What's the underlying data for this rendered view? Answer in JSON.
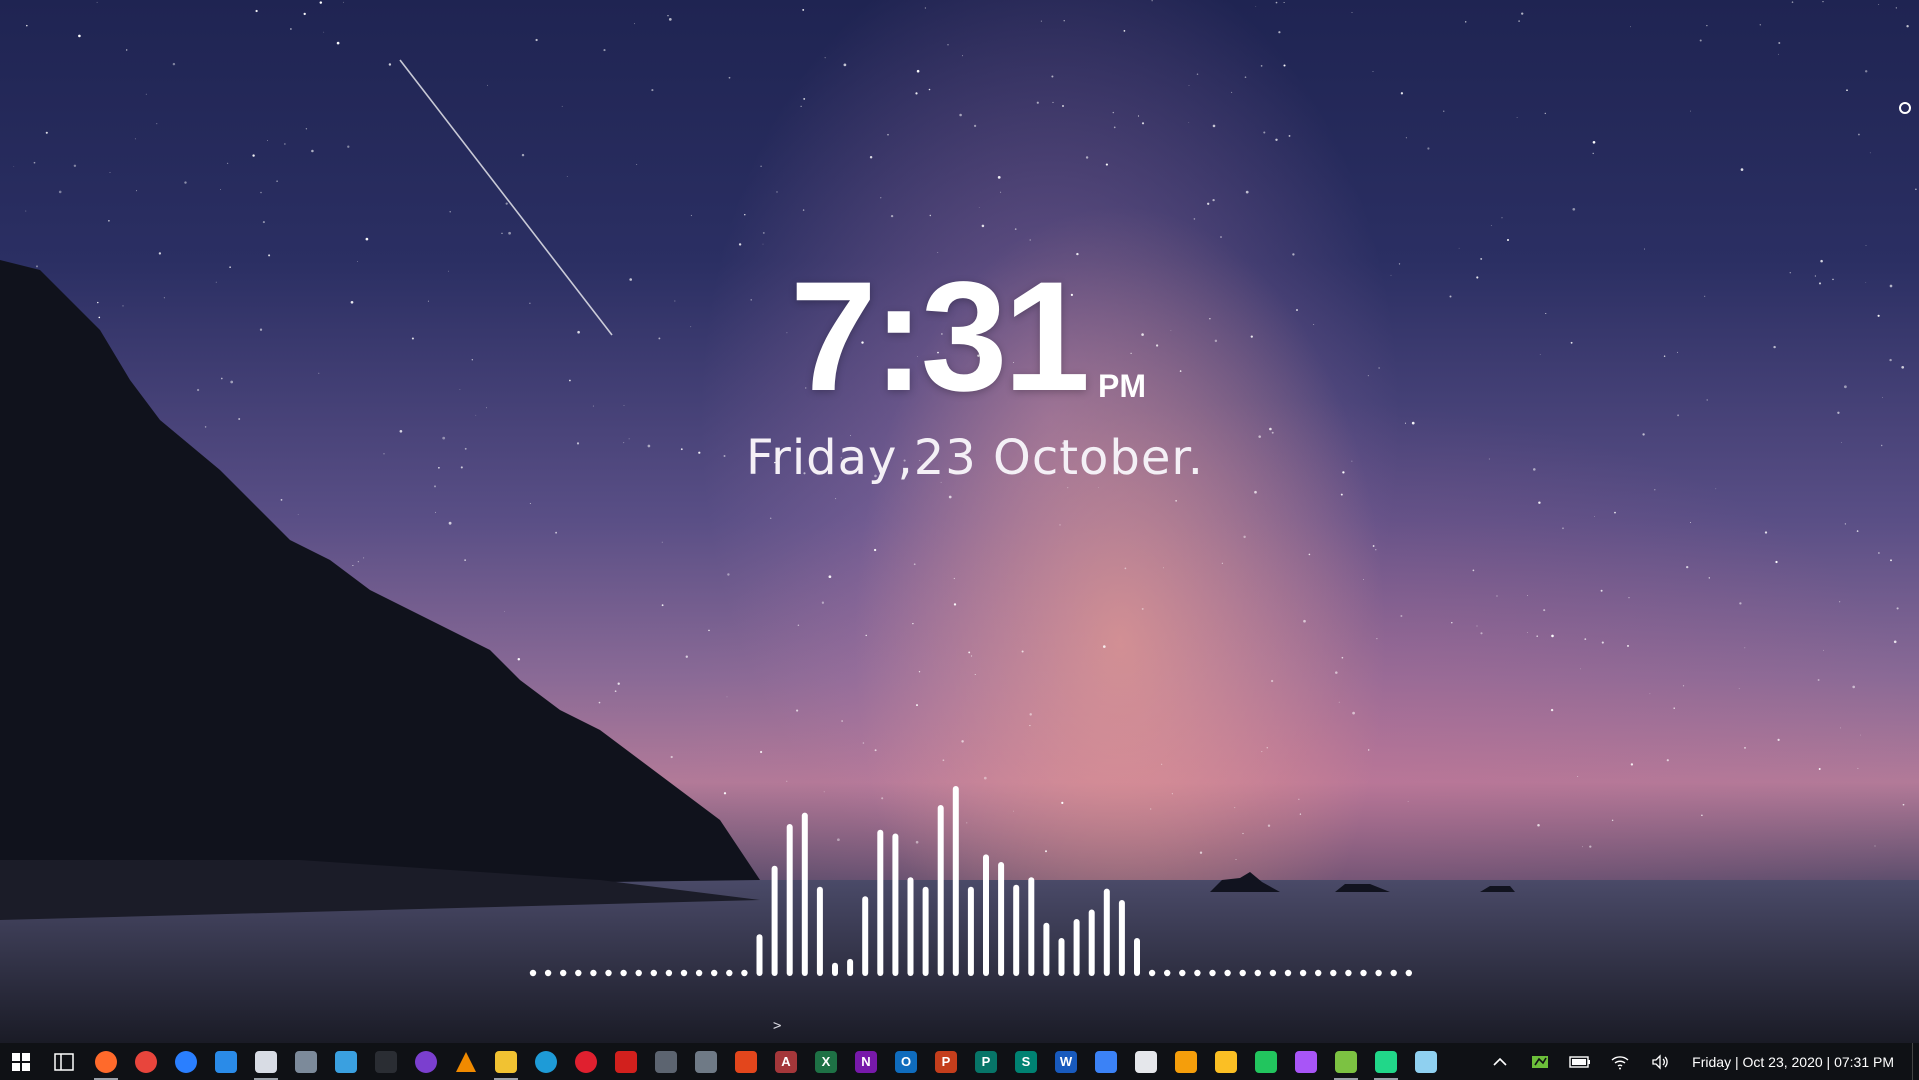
{
  "clock": {
    "time": "7:31",
    "ampm": "PM",
    "date": "Friday,23 October."
  },
  "prompt": {
    "caret": ">"
  },
  "visualizer": {
    "levels": [
      0,
      0,
      0,
      0,
      0,
      0,
      0,
      0,
      0,
      0,
      0,
      0,
      0,
      0,
      0,
      0.22,
      0.58,
      0.8,
      0.86,
      0.47,
      0.07,
      0.09,
      0.42,
      0.77,
      0.75,
      0.52,
      0.47,
      0.9,
      1.0,
      0.47,
      0.64,
      0.6,
      0.48,
      0.52,
      0.28,
      0.2,
      0.3,
      0.35,
      0.46,
      0.4,
      0.2,
      0,
      0,
      0,
      0,
      0,
      0,
      0,
      0,
      0,
      0,
      0,
      0,
      0,
      0,
      0,
      0,
      0,
      0
    ]
  },
  "taskbar": {
    "start": {
      "icon": "windows-start-icon"
    },
    "task_view": {
      "icon": "task-view-icon"
    },
    "apps": [
      {
        "name": "firefox",
        "icon": "firefox-icon",
        "color": "#ff6a2b",
        "glyph": "",
        "active": true
      },
      {
        "name": "chrome",
        "icon": "chrome-icon",
        "color": "#e8453c",
        "glyph": "",
        "active": false
      },
      {
        "name": "firefox-nightly",
        "icon": "firefox-blue-icon",
        "color": "#2a7fff",
        "glyph": "",
        "active": false
      },
      {
        "name": "vscode",
        "icon": "vscode-icon",
        "color": "#2a8be8",
        "glyph": "",
        "active": false
      },
      {
        "name": "notepad",
        "icon": "notepad-icon",
        "color": "#d8dce4",
        "glyph": "",
        "active": true
      },
      {
        "name": "calculator",
        "icon": "calculator-icon",
        "color": "#7c8a9a",
        "glyph": "",
        "active": false
      },
      {
        "name": "remote-desktop",
        "icon": "remote-desktop-icon",
        "color": "#3aa0e0",
        "glyph": "",
        "active": false
      },
      {
        "name": "terminal",
        "icon": "terminal-icon",
        "color": "#2a2d33",
        "glyph": "",
        "active": false
      },
      {
        "name": "tor",
        "icon": "tor-browser-icon",
        "color": "#7b3fcf",
        "glyph": "",
        "active": false
      },
      {
        "name": "vlc",
        "icon": "vlc-icon",
        "color": "#f08a00",
        "glyph": "",
        "active": false
      },
      {
        "name": "file-explorer",
        "icon": "folder-icon",
        "color": "#f1c232",
        "glyph": "",
        "active": true
      },
      {
        "name": "edge",
        "icon": "edge-icon",
        "color": "#1e9bd7",
        "glyph": "",
        "active": false
      },
      {
        "name": "opera",
        "icon": "opera-icon",
        "color": "#e0202f",
        "glyph": "",
        "active": false
      },
      {
        "name": "acrobat",
        "icon": "acrobat-icon",
        "color": "#d2201d",
        "glyph": "",
        "active": false
      },
      {
        "name": "snipping",
        "icon": "scissors-icon",
        "color": "#5c6470",
        "glyph": "",
        "active": false
      },
      {
        "name": "linux-tool",
        "icon": "penguin-icon",
        "color": "#6f7a86",
        "glyph": "",
        "active": false
      },
      {
        "name": "office",
        "icon": "office-icon",
        "color": "#e3461c",
        "glyph": "",
        "active": false
      },
      {
        "name": "access",
        "icon": "access-icon",
        "color": "#a4373a",
        "glyph": "A",
        "active": false
      },
      {
        "name": "excel",
        "icon": "excel-icon",
        "color": "#1e7145",
        "glyph": "X",
        "active": false
      },
      {
        "name": "onenote",
        "icon": "onenote-icon",
        "color": "#7719aa",
        "glyph": "N",
        "active": false
      },
      {
        "name": "outlook",
        "icon": "outlook-icon",
        "color": "#0f6cbd",
        "glyph": "O",
        "active": false
      },
      {
        "name": "powerpoint",
        "icon": "powerpoint-icon",
        "color": "#c43e1c",
        "glyph": "P",
        "active": false
      },
      {
        "name": "publisher",
        "icon": "publisher-icon",
        "color": "#077568",
        "glyph": "P",
        "active": false
      },
      {
        "name": "sway",
        "icon": "sway-icon",
        "color": "#008272",
        "glyph": "S",
        "active": false
      },
      {
        "name": "word",
        "icon": "word-icon",
        "color": "#185abd",
        "glyph": "W",
        "active": false
      },
      {
        "name": "docs",
        "icon": "document-icon",
        "color": "#3b82f6",
        "glyph": "",
        "active": false
      },
      {
        "name": "text-file",
        "icon": "text-file-icon",
        "color": "#e5e7eb",
        "glyph": "",
        "active": false
      },
      {
        "name": "slides-orange",
        "icon": "slides-icon",
        "color": "#f59e0b",
        "glyph": "",
        "active": false
      },
      {
        "name": "keep",
        "icon": "keep-icon",
        "color": "#fbbf24",
        "glyph": "",
        "active": false
      },
      {
        "name": "sheets",
        "icon": "sheets-icon",
        "color": "#22c55e",
        "glyph": "",
        "active": false
      },
      {
        "name": "forms",
        "icon": "forms-icon",
        "color": "#a855f7",
        "glyph": "",
        "active": false
      },
      {
        "name": "rainmeter-green",
        "icon": "rainmeter-icon",
        "color": "#7cc242",
        "glyph": "",
        "active": true
      },
      {
        "name": "pycharm",
        "icon": "pycharm-icon",
        "color": "#21d789",
        "glyph": "",
        "active": true
      },
      {
        "name": "eraser",
        "icon": "eraser-icon",
        "color": "#8fd0f0",
        "glyph": "",
        "active": false
      }
    ],
    "tray": {
      "items": [
        "chevron-up-icon",
        "gpu-icon",
        "battery-icon",
        "wifi-icon",
        "volume-icon"
      ],
      "clock": "Friday | Oct 23, 2020 | 07:31 PM"
    }
  }
}
